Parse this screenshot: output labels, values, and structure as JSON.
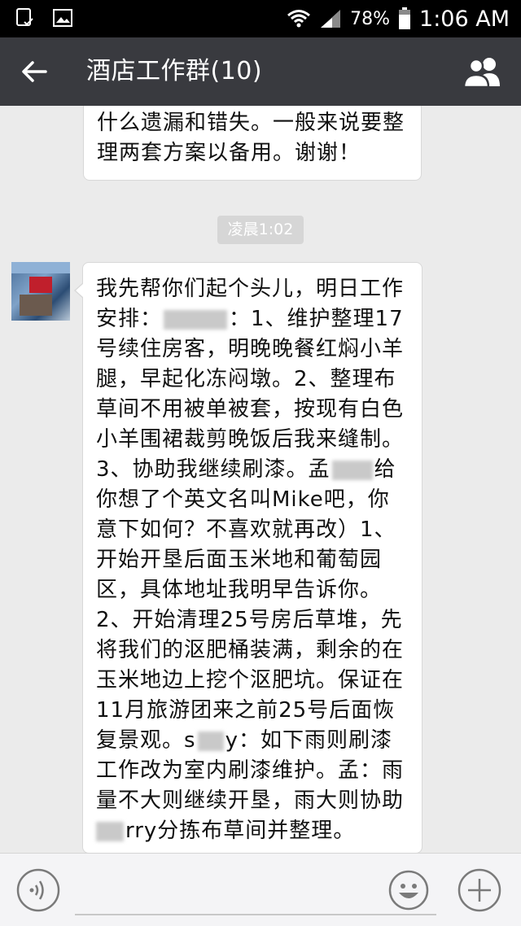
{
  "status_bar": {
    "battery": "78%",
    "time": "1:06 AM"
  },
  "header": {
    "title": "酒店工作群(10)"
  },
  "messages": {
    "previous": {
      "lines": [
        "什么遗漏和错失。一般来说要整",
        "理两套方案以备用。谢谢！"
      ]
    },
    "timestamp": "凌晨1:02",
    "main": {
      "lines": [
        "我先帮你们起个头儿，明日工作",
        "安排：",
        "：1、维护整理17",
        "号续住房客，明晚晚餐红焖小羊",
        "腿，早起化冻闷墩。2、整理布",
        "草间不用被单被套，按现有白色",
        "小羊围裙裁剪晚饭后我来缝制。",
        "3、协助我继续刷漆。孟",
        "给",
        "你想了个英文名叫Mike吧，你",
        "意下如何？不喜欢就再改）1、",
        "开始开垦后面玉米地和葡萄园",
        "区，具体地址我明早告诉你。",
        "2、开始清理25号房后草堆，先",
        "将我们的沤肥桶装满，剩余的在",
        "玉米地边上挖个沤肥坑。保证在",
        "11月旅游团来之前25号后面恢",
        "复景观。",
        "s",
        "y：如下雨则刷漆",
        "工作改为室内刷漆维护。孟：雨",
        "量不大则继续开垦，雨大则协助",
        "rry分拣布草间并整理。"
      ]
    }
  },
  "icons": {
    "status_left": [
      "screenshot-icon",
      "gallery-icon"
    ],
    "status_right": [
      "wifi-icon",
      "signal-icon",
      "battery-icon"
    ],
    "header_left": "back-arrow-icon",
    "header_right": "group-members-icon",
    "input_left": "voice-icon",
    "input_right": [
      "emoji-icon",
      "plus-icon"
    ]
  },
  "colors": {
    "header_bg": "#393a3f",
    "chat_bg": "#ebebeb",
    "bubble_bg": "#ffffff"
  }
}
